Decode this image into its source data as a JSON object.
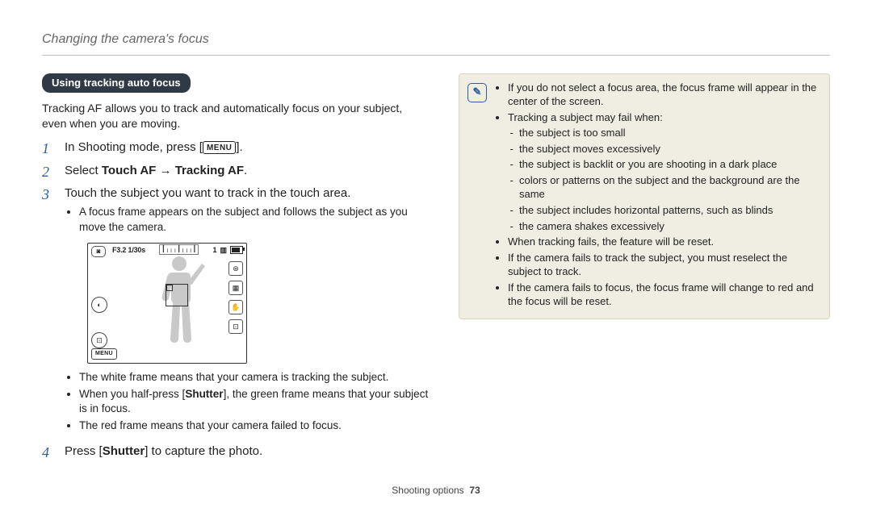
{
  "header": "Changing the camera's focus",
  "tag": "Using tracking auto focus",
  "lead": "Tracking AF allows you to track and automatically focus on your subject, even when you are moving.",
  "steps": {
    "s1": {
      "num": "1",
      "pre": "In Shooting mode, press [",
      "menu": "MENU",
      "post": "]."
    },
    "s2": {
      "num": "2",
      "pre": "Select ",
      "bold1": "Touch AF",
      "arrow": " → ",
      "bold2": "Tracking AF",
      "post": "."
    },
    "s3": {
      "num": "3",
      "text": "Touch the subject you want to track in the touch area.",
      "sub1": "A focus frame appears on the subject and follows the subject as you move the camera."
    },
    "s4": {
      "num": "4",
      "pre": "Press [",
      "bold": "Shutter",
      "post": "] to capture the photo."
    }
  },
  "screen": {
    "top": "F3.2  1/30s",
    "count": "1",
    "menu": "MENU"
  },
  "notes": {
    "n1": "The white frame means that your camera is tracking the subject.",
    "n2_pre": "When you half-press [",
    "n2_bold": "Shutter",
    "n2_post": "], the green frame means that your subject is in focus.",
    "n3": "The red frame means that your camera failed to focus."
  },
  "noteBox": {
    "b1": "If you do not select a focus area, the focus frame will appear in the center of the screen.",
    "b2": "Tracking a subject may fail when:",
    "b2a": "the subject is too small",
    "b2b": "the subject moves excessively",
    "b2c": "the subject is backlit or you are shooting in a dark place",
    "b2d": "colors or patterns on the subject and the background are the same",
    "b2e": "the subject includes horizontal patterns, such as blinds",
    "b2f": "the camera shakes excessively",
    "b3": "When tracking fails, the feature will be reset.",
    "b4": "If the camera fails to track the subject, you must reselect the subject to track.",
    "b5": "If the camera fails to focus, the focus frame will change to red and the focus will be reset."
  },
  "footer": {
    "section": "Shooting options",
    "page": "73"
  }
}
